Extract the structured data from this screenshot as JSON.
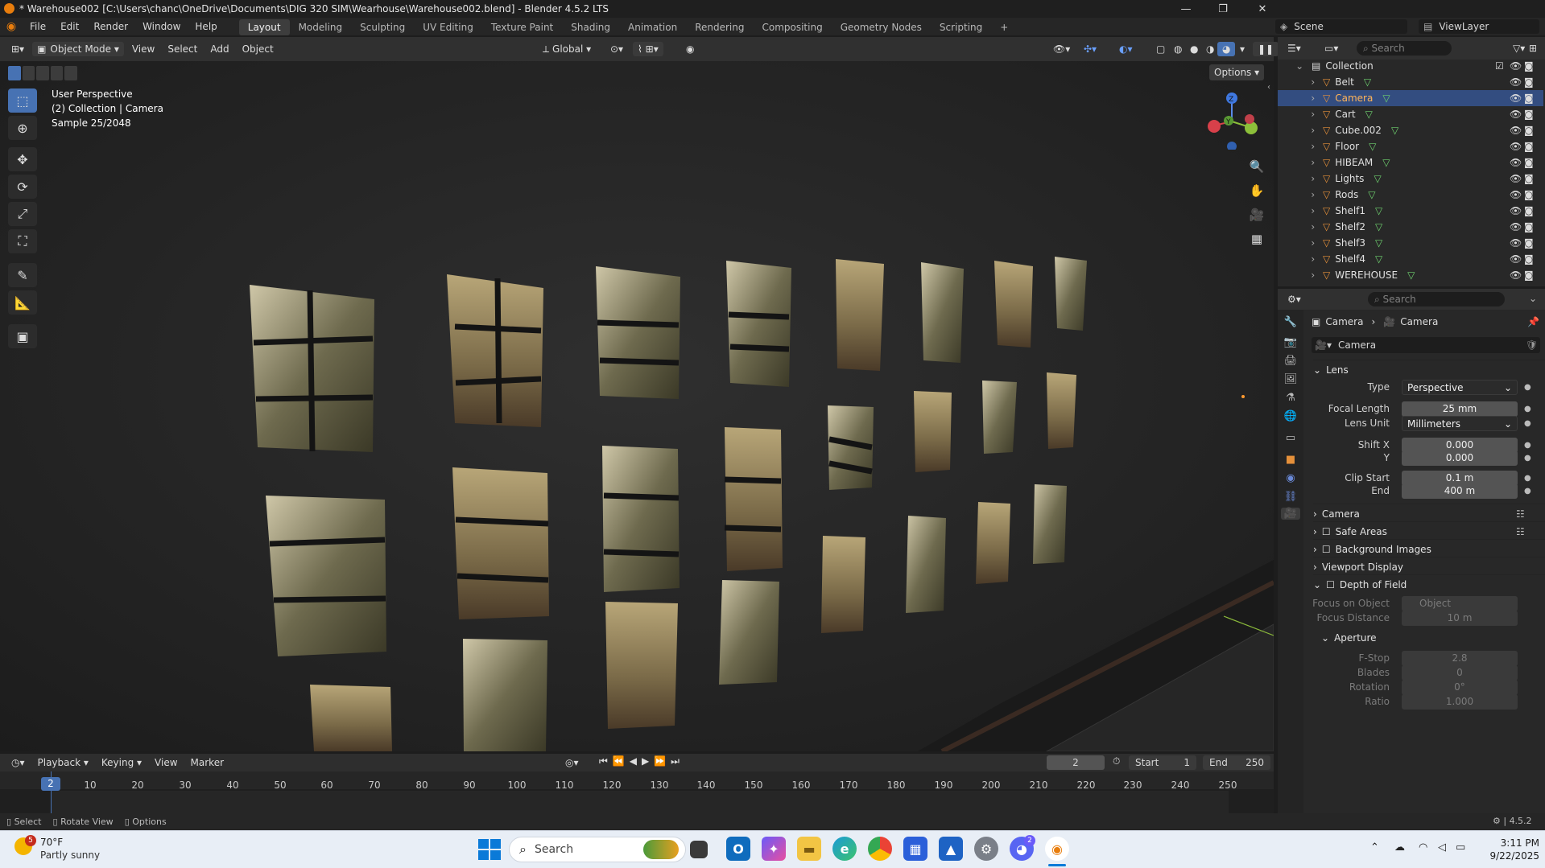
{
  "window": {
    "title": "* Warehouse002 [C:\\Users\\chanc\\OneDrive\\Documents\\DIG 320 SIM\\Wearhouse\\Warehouse002.blend] - Blender 4.5.2 LTS",
    "minimize": "—",
    "maximize": "❐",
    "close": "✕"
  },
  "menu": {
    "items": [
      "File",
      "Edit",
      "Render",
      "Window",
      "Help"
    ],
    "workspaces": [
      "Layout",
      "Modeling",
      "Sculpting",
      "UV Editing",
      "Texture Paint",
      "Shading",
      "Animation",
      "Rendering",
      "Compositing",
      "Geometry Nodes",
      "Scripting"
    ],
    "add_workspace": "+",
    "scene": "Scene",
    "view_layer": "ViewLayer"
  },
  "viewport": {
    "mode": "Object Mode",
    "menus": [
      "View",
      "Select",
      "Add",
      "Object"
    ],
    "orientation": "Global",
    "options": "Options",
    "info_line1": "User Perspective",
    "info_line2": "(2) Collection | Camera",
    "info_line3": "Sample 25/2048",
    "gizmo_z": "Z",
    "gizmo_y": "Y"
  },
  "outliner": {
    "search_placeholder": "Search",
    "collection": "Collection",
    "items": [
      {
        "name": "Belt",
        "selected": false
      },
      {
        "name": "Camera",
        "selected": true
      },
      {
        "name": "Cart",
        "selected": false
      },
      {
        "name": "Cube.002",
        "selected": false
      },
      {
        "name": "Floor",
        "selected": false
      },
      {
        "name": "HIBEAM",
        "selected": false
      },
      {
        "name": "Lights",
        "selected": false
      },
      {
        "name": "Rods",
        "selected": false
      },
      {
        "name": "Shelf1",
        "selected": false
      },
      {
        "name": "Shelf2",
        "selected": false
      },
      {
        "name": "Shelf3",
        "selected": false
      },
      {
        "name": "Shelf4",
        "selected": false
      },
      {
        "name": "WEREHOUSE",
        "selected": false
      }
    ]
  },
  "properties": {
    "search_placeholder": "Search",
    "breadcrumb_object": "Camera",
    "breadcrumb_data": "Camera",
    "datablock": "Camera",
    "lens_section": "Lens",
    "type_label": "Type",
    "type_value": "Perspective",
    "focal_label": "Focal Length",
    "focal_value": "25 mm",
    "lens_unit_label": "Lens Unit",
    "lens_unit_value": "Millimeters",
    "shiftx_label": "Shift X",
    "shiftx_value": "0.000",
    "shifty_label": "Y",
    "shifty_value": "0.000",
    "clipstart_label": "Clip Start",
    "clipstart_value": "0.1 m",
    "clipend_label": "End",
    "clipend_value": "400 m",
    "camera_section": "Camera",
    "safe_areas_section": "Safe Areas",
    "bg_images_section": "Background Images",
    "viewport_display_section": "Viewport Display",
    "dof_section": "Depth of Field",
    "focus_object_label": "Focus on Object",
    "focus_object_placeholder": "Object",
    "focus_distance_label": "Focus Distance",
    "focus_distance_value": "10 m",
    "aperture_section": "Aperture",
    "fstop_label": "F-Stop",
    "fstop_value": "2.8",
    "blades_label": "Blades",
    "blades_value": "0",
    "rotation_label": "Rotation",
    "rotation_value": "0°",
    "ratio_label": "Ratio",
    "ratio_value": "1.000"
  },
  "timeline": {
    "menus": [
      "Playback",
      "Keying",
      "View",
      "Marker"
    ],
    "current_frame": "2",
    "start_label": "Start",
    "start_value": "1",
    "end_label": "End",
    "end_value": "250",
    "playhead": "2",
    "ticks": [
      "10",
      "20",
      "30",
      "40",
      "50",
      "60",
      "70",
      "80",
      "90",
      "100",
      "110",
      "120",
      "130",
      "140",
      "150",
      "160",
      "170",
      "180",
      "190",
      "200",
      "210",
      "220",
      "230",
      "240",
      "250"
    ]
  },
  "statusbar": {
    "select": "Select",
    "rotate": "Rotate View",
    "options": "Options",
    "version": "4.5.2"
  },
  "taskbar": {
    "weather_temp": "70°F",
    "weather_desc": "Partly sunny",
    "weather_badge": "5",
    "search_placeholder": "Search",
    "time": "3:11 PM",
    "date": "9/22/2025",
    "discord_badge": "2"
  },
  "colors": {
    "accent_blue": "#4772b3",
    "selected_row": "#334d80",
    "object_orange": "#e5903a",
    "mesh_green": "#6fd16f"
  }
}
